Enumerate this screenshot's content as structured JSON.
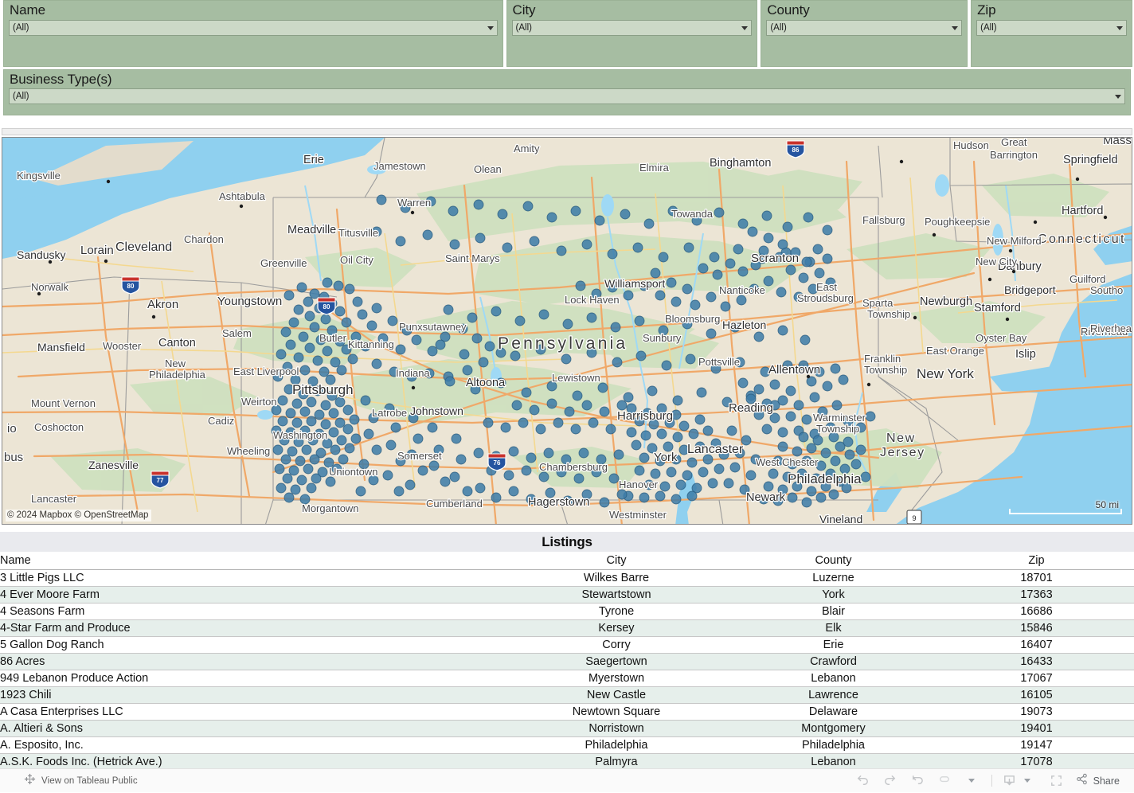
{
  "filters": [
    {
      "label": "Name",
      "value": "(All)",
      "key": "name"
    },
    {
      "label": "City",
      "value": "(All)",
      "key": "city"
    },
    {
      "label": "County",
      "value": "(All)",
      "key": "county"
    },
    {
      "label": "Zip",
      "value": "(All)",
      "key": "zip"
    },
    {
      "label": "Business Type(s)",
      "value": "(All)",
      "key": "business_types"
    }
  ],
  "map": {
    "attribution": "© 2024 Mapbox  © OpenStreetMap",
    "scale_label": "50 mi",
    "marker_color": "#3d7ba8",
    "marker_border_color": "#2b5c80",
    "water_color": "#8fd0ef",
    "land_color": "#ece5d5",
    "green_color": "#cfe0bf",
    "road_color": "#f0a868",
    "highway_shields": [
      "80",
      "80",
      "77",
      "86",
      "76",
      "9"
    ],
    "labels": [
      "Erie",
      "Jamestown",
      "Olean",
      "Amity",
      "Elmira",
      "Binghamton",
      "Hudson",
      "Great Barrington",
      "Springfield",
      "Massachusetts",
      "Kingsville",
      "Ashtabula",
      "Warren",
      "Meadville",
      "Titusville",
      "Towanda",
      "Fallsburg",
      "Poughkeepsie",
      "Hartford",
      "Connecticut",
      "New Milford",
      "Danbury",
      "Cleveland",
      "Chardon",
      "Lorain",
      "Sandusky",
      "Norwalk",
      "Oil City",
      "Greenville",
      "Saint Marys",
      "Williamsport",
      "Lock Haven",
      "Scranton",
      "Nanticoke",
      "East Stroudsburg",
      "Sparta Township",
      "Newburgh",
      "New City",
      "Stamford",
      "Bridgeport",
      "Guilford",
      "Southold",
      "Akron",
      "Youngstown",
      "Salem",
      "Punxsutawney",
      "Pennsylvania",
      "Bloomsburg",
      "Hazleton",
      "New York",
      "Oyster Bay",
      "Islip",
      "Riverhead",
      "East Orange",
      "Mansfield",
      "Wooster",
      "Canton",
      "Butler",
      "Kittanning",
      "Sunbury",
      "Pottsville",
      "Allentown",
      "Franklin Township",
      "Mount Vernon",
      "New Philadelphia",
      "East Liverpool",
      "Weirton",
      "Indiana",
      "Altoona",
      "Lewistown",
      "Pittsburgh",
      "Latrobe",
      "Johnstown",
      "Harrisburg",
      "Reading",
      "Warminster Township",
      "New Jersey",
      "Coshocton",
      "Cadiz",
      "Washington",
      "Zanesville",
      "Wheeling",
      "Somerset",
      "Chambersburg",
      "Lancaster City",
      "York",
      "West Chester",
      "Philadelphia",
      "Newark",
      "Uniontown",
      "Hanover",
      "Morgantown",
      "Cumberland",
      "Hagerstown",
      "Westminster",
      "Vineland",
      "Ohio",
      "Columbus",
      "Lancaster"
    ]
  },
  "listings": {
    "title": "Listings",
    "columns": [
      "Name",
      "City",
      "County",
      "Zip"
    ],
    "rows": [
      {
        "name": "3 Little Pigs LLC",
        "city": "Wilkes Barre",
        "county": "Luzerne",
        "zip": "18701"
      },
      {
        "name": "4 Ever Moore Farm",
        "city": "Stewartstown",
        "county": "York",
        "zip": "17363"
      },
      {
        "name": "4 Seasons Farm",
        "city": "Tyrone",
        "county": "Blair",
        "zip": "16686"
      },
      {
        "name": "4-Star Farm and Produce",
        "city": "Kersey",
        "county": "Elk",
        "zip": "15846"
      },
      {
        "name": "5 Gallon Dog Ranch",
        "city": "Corry",
        "county": "Erie",
        "zip": "16407"
      },
      {
        "name": "86 Acres",
        "city": "Saegertown",
        "county": "Crawford",
        "zip": "16433"
      },
      {
        "name": "949 Lebanon Produce Action",
        "city": "Myerstown",
        "county": "Lebanon",
        "zip": "17067"
      },
      {
        "name": "1923 Chili",
        "city": "New Castle",
        "county": "Lawrence",
        "zip": "16105"
      },
      {
        "name": "A Casa Enterprises LLC",
        "city": "Newtown Square",
        "county": "Delaware",
        "zip": "19073"
      },
      {
        "name": "A. Altieri & Sons",
        "city": "Norristown",
        "county": "Montgomery",
        "zip": "19401"
      },
      {
        "name": "A. Esposito, Inc.",
        "city": "Philadelphia",
        "county": "Philadelphia",
        "zip": "19147"
      },
      {
        "name": "A.S.K. Foods Inc. (Hetrick Ave.)",
        "city": "Palmyra",
        "county": "Lebanon",
        "zip": "17078"
      }
    ]
  },
  "toolbar": {
    "view_on_tableau_public": "View on Tableau Public",
    "tableau_icon": "tableau-logo-icon",
    "buttons": [
      {
        "name": "undo-button",
        "icon": "undo-icon"
      },
      {
        "name": "redo-button",
        "icon": "redo-icon"
      },
      {
        "name": "revert-button",
        "icon": "revert-icon"
      },
      {
        "name": "refresh-button",
        "icon": "refresh-icon"
      },
      {
        "name": "pause-dropdown-button",
        "icon": "chevron-down-icon"
      },
      {
        "name": "download-button",
        "icon": "download-icon"
      },
      {
        "name": "download-dropdown",
        "icon": "chevron-down-icon"
      },
      {
        "name": "fullscreen-button",
        "icon": "fullscreen-icon"
      }
    ],
    "share_label": "Share",
    "share_icon": "share-icon"
  }
}
